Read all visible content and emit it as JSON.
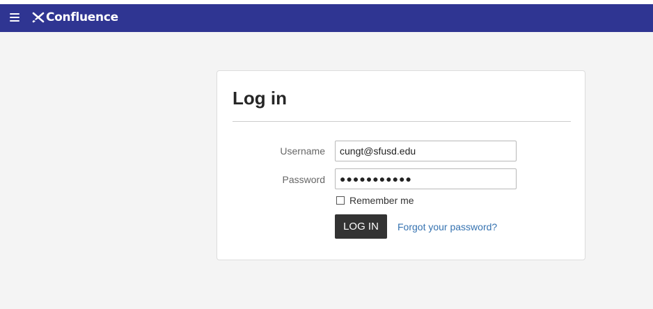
{
  "header": {
    "app_name": "Confluence",
    "brand_color": "#2f3592",
    "menu_icon": "hamburger-menu-icon",
    "logo_icon": "confluence-logo-icon"
  },
  "login": {
    "title": "Log in",
    "username_label": "Username",
    "username_value": "cungt@sfusd.edu",
    "password_label": "Password",
    "password_value": "●●●●●●●●●●●",
    "remember_label": "Remember me",
    "remember_checked": false,
    "submit_label": "LOG IN",
    "forgot_label": "Forgot your password?"
  }
}
